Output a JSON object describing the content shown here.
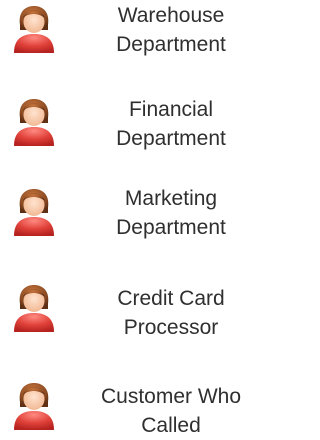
{
  "actors": [
    {
      "label": "Warehouse\nDepartment",
      "icon": "female-user-icon"
    },
    {
      "label": "Financial\nDepartment",
      "icon": "female-user-icon"
    },
    {
      "label": "Marketing\nDepartment",
      "icon": "female-user-icon"
    },
    {
      "label": "Credit Card\nProcessor",
      "icon": "female-user-icon"
    },
    {
      "label": "Customer Who\nCalled",
      "icon": "female-user-icon"
    }
  ],
  "colors": {
    "hair": "#8a4a22",
    "skin": "#f4c2a0",
    "body": "#d9342f",
    "text": "#2f2f2f"
  }
}
